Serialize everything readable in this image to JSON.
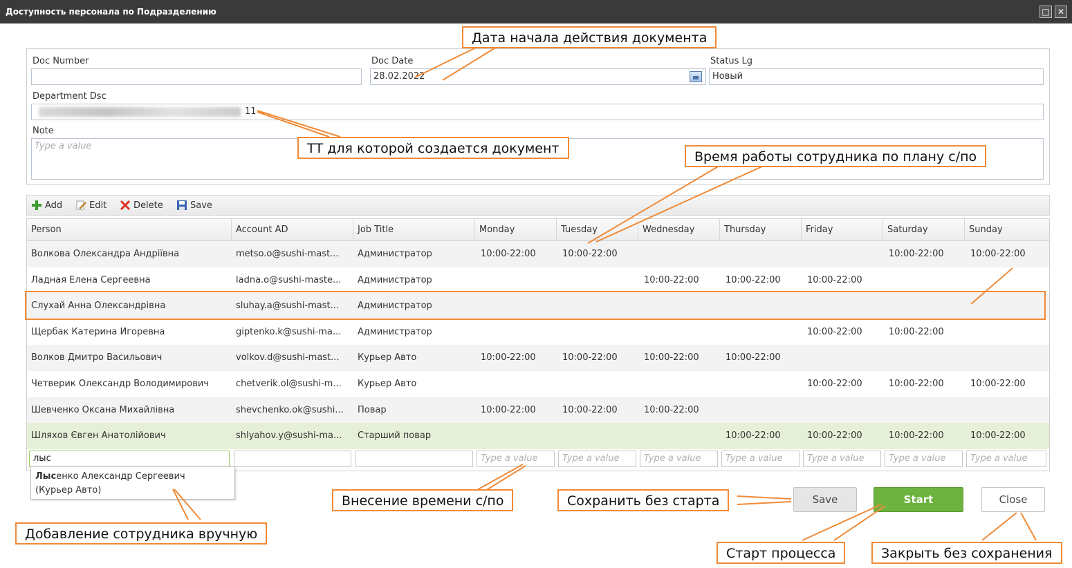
{
  "window": {
    "title": "Доступность персонала по Подразделению"
  },
  "form": {
    "doc_number": {
      "label": "Doc Number",
      "value": ""
    },
    "doc_date": {
      "label": "Doc Date",
      "value": "28.02.2022"
    },
    "status": {
      "label": "Status Lg",
      "value": "Новый"
    },
    "department": {
      "label": "Department Dsc",
      "value_suffix": "11"
    },
    "note": {
      "label": "Note",
      "placeholder": "Type a value"
    }
  },
  "toolbar": {
    "add": "Add",
    "edit": "Edit",
    "delete": "Delete",
    "save": "Save"
  },
  "grid": {
    "headers": [
      "Person",
      "Account AD",
      "Job Title",
      "Monday",
      "Tuesday",
      "Wednesday",
      "Thursday",
      "Friday",
      "Saturday",
      "Sunday"
    ],
    "rows": [
      [
        "Волкова Олександра Андріївна",
        "metso.o@sushi-mast...",
        "Администратор",
        "10:00-22:00",
        "10:00-22:00",
        "",
        "",
        "",
        "10:00-22:00",
        "10:00-22:00"
      ],
      [
        "Ладная Елена Сергеевна",
        "ladna.o@sushi-maste...",
        "Администратор",
        "",
        "",
        "10:00-22:00",
        "10:00-22:00",
        "10:00-22:00",
        "",
        ""
      ],
      [
        "Слухай Анна Олександрівна",
        "sluhay.a@sushi-mast...",
        "Администратор",
        "",
        "",
        "",
        "",
        "",
        "",
        ""
      ],
      [
        "Щербак Катерина Игоревна",
        "giptenko.k@sushi-ma...",
        "Администратор",
        "",
        "",
        "",
        "",
        "10:00-22:00",
        "10:00-22:00",
        ""
      ],
      [
        "Волков Дмитро Васильович",
        "volkov.d@sushi-mast...",
        "Курьер Авто",
        "10:00-22:00",
        "10:00-22:00",
        "10:00-22:00",
        "10:00-22:00",
        "",
        "",
        ""
      ],
      [
        "Четверик Олександр Володимирович",
        "chetverik.ol@sushi-m...",
        "Курьер Авто",
        "",
        "",
        "",
        "",
        "10:00-22:00",
        "10:00-22:00",
        "10:00-22:00"
      ],
      [
        "Шевченко Оксана Михайлівна",
        "shevchenko.ok@sushi...",
        "Повар",
        "10:00-22:00",
        "10:00-22:00",
        "10:00-22:00",
        "",
        "",
        "",
        ""
      ],
      [
        "Шляхов Євген Анатолійович",
        "shlyahov.y@sushi-ma...",
        "Старший повар",
        "",
        "",
        "",
        "10:00-22:00",
        "10:00-22:00",
        "10:00-22:00",
        "10:00-22:00"
      ]
    ],
    "edit_row": {
      "person_value": "лыс",
      "day_placeholder": "Type a value"
    }
  },
  "autocomplete": {
    "match": "Лыс",
    "rest": "енко Александр Сергеевич",
    "job": "(Курьер Авто)"
  },
  "buttons": {
    "save": "Save",
    "start": "Start",
    "close": "Close"
  },
  "annotations": {
    "doc_date": "Дата начала действия документа",
    "department": "ТТ для которой создается документ",
    "work_time": "Время работы сотрудника по плану с/по",
    "time_entry": "Внесение времени с/по",
    "save_no_start": "Сохранить без старта",
    "add_manual": "Добавление сотрудника вручную",
    "start_process": "Старт процесса",
    "close_no_save": "Закрыть без сохранения"
  },
  "colors": {
    "accent_orange": "#f08a37",
    "start_green": "#6db33f",
    "selected_row": "#e6f0d8",
    "titlebar": "#3a3a3a"
  }
}
